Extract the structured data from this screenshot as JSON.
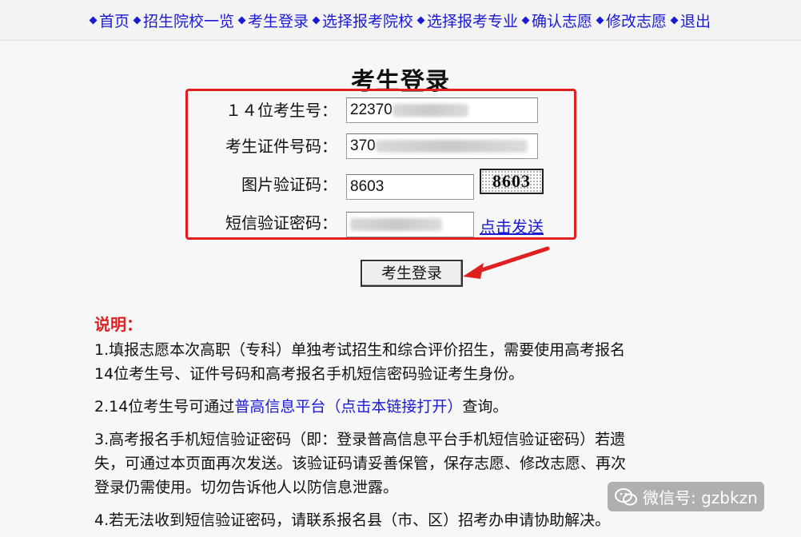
{
  "nav": {
    "items": [
      {
        "label": "首页"
      },
      {
        "label": "招生院校一览"
      },
      {
        "label": "考生登录"
      },
      {
        "label": "选择报考院校"
      },
      {
        "label": "选择报考专业"
      },
      {
        "label": "确认志愿"
      },
      {
        "label": "修改志愿"
      },
      {
        "label": "退出"
      }
    ]
  },
  "page_title": "考生登录",
  "form": {
    "exam_no": {
      "label": "１４位考生号：",
      "value": "22370"
    },
    "id_no": {
      "label": "考生证件号码：",
      "value": "370"
    },
    "captcha": {
      "label": "图片验证码：",
      "value": "8603",
      "image_text": "8603"
    },
    "sms": {
      "label": "短信验证密码：",
      "send_link": "点击发送"
    }
  },
  "login_button": "考生登录",
  "notes": {
    "title": "说明：",
    "n1_line1": "1.填报志愿本次高职（专科）单独考试招生和综合评价招生，需要使用高考报名",
    "n1_line2": "14位考生号、证件号码和高考报名手机短信密码验证考生身份。",
    "n2_pre": "2.14位考生号可通过",
    "n2_link": "普高信息平台（点击本链接打开）",
    "n2_post": "查询。",
    "n3_line1": "3.高考报名手机短信验证密码（即：登录普高信息平台手机短信验证密码）若遗",
    "n3_line2": "失，可通过本页面再次发送。该验证码请妥善保管，保存志愿、修改志愿、再次",
    "n3_line3": "登录仍需使用。切勿告诉他人以防信息泄露。",
    "n4": "4.若无法收到短信验证密码，请联系报名县（市、区）招考办申请协助解决。"
  },
  "watermark": "微信号: gzbkzn",
  "colors": {
    "link": "#1a1ad6",
    "highlight_border": "#e02020",
    "arrow": "#e02020"
  }
}
